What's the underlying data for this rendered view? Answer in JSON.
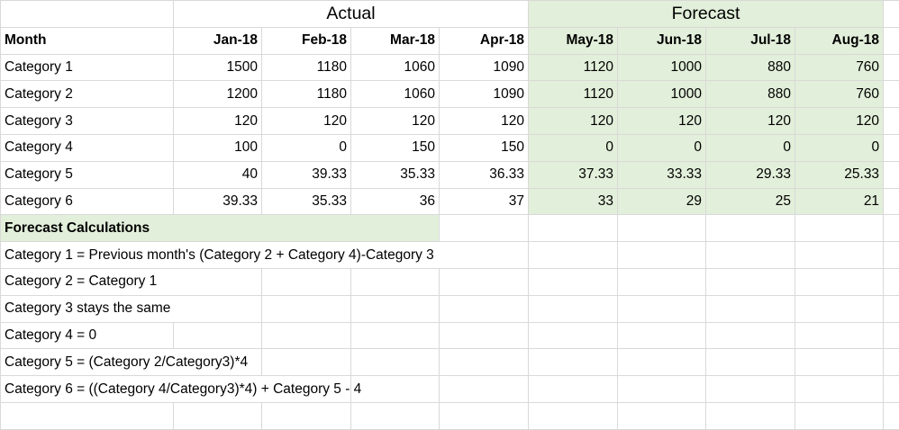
{
  "groups": {
    "actual": "Actual",
    "forecast": "Forecast"
  },
  "header": [
    "Month",
    "Jan-18",
    "Feb-18",
    "Mar-18",
    "Apr-18",
    "May-18",
    "Jun-18",
    "Jul-18",
    "Aug-18"
  ],
  "rows": [
    [
      "Category 1",
      "1500",
      "1180",
      "1060",
      "1090",
      "1120",
      "1000",
      "880",
      "760"
    ],
    [
      "Category 2",
      "1200",
      "1180",
      "1060",
      "1090",
      "1120",
      "1000",
      "880",
      "760"
    ],
    [
      "Category 3",
      "120",
      "120",
      "120",
      "120",
      "120",
      "120",
      "120",
      "120"
    ],
    [
      "Category 4",
      "100",
      "0",
      "150",
      "150",
      "0",
      "0",
      "0",
      "0"
    ],
    [
      "Category 5",
      "40",
      "39.33",
      "35.33",
      "36.33",
      "37.33",
      "33.33",
      "29.33",
      "25.33"
    ],
    [
      "Category 6",
      "39.33",
      "35.33",
      "36",
      "37",
      "33",
      "29",
      "25",
      "21"
    ]
  ],
  "calc_title": "Forecast Calculations",
  "calc_notes": [
    "Category 1 = Previous month's (Category 2 + Category 4)-Category 3",
    "Category 2 = Category 1",
    "Category 3 stays the same",
    "Category 4 = 0",
    "Category 5 = (Category 2/Category3)*4",
    "Category 6 = ((Category 4/Category3)*4) + Category 5 - 4"
  ],
  "colors": {
    "forecast_fill": "#e2efda",
    "grid": "#d9d9d9"
  }
}
